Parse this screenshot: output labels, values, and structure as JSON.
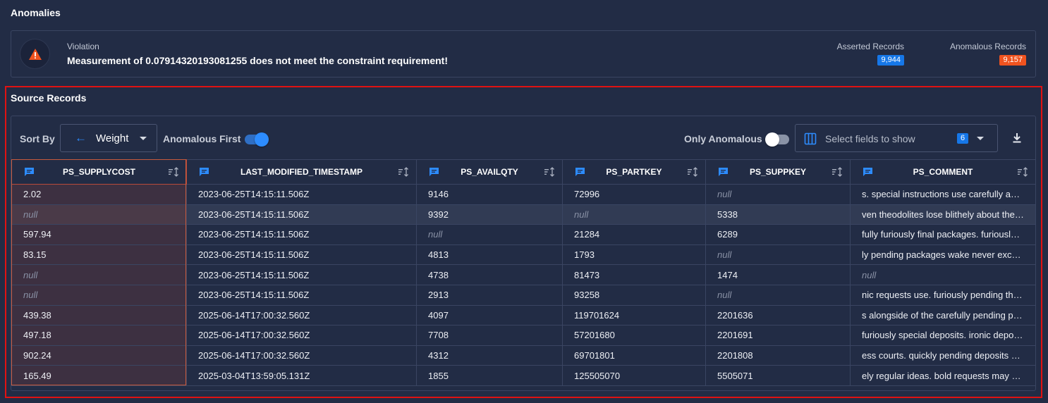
{
  "anomalies": {
    "title": "Anomalies",
    "violation_label": "Violation",
    "violation_text": "Measurement of 0.07914320193081255 does not meet the constraint requirement!",
    "asserted_label": "Asserted Records",
    "asserted_count": "9,944",
    "anomalous_label": "Anomalous Records",
    "anomalous_count": "9,157",
    "icon": "warning-triangle-icon",
    "accent_orange": "#f0531f",
    "accent_blue": "#1677e8"
  },
  "source": {
    "title": "Source Records",
    "sort_by_label": "Sort By",
    "sort_value": "Weight",
    "anomalous_first_label": "Anomalous First",
    "anomalous_first_on": true,
    "only_anomalous_label": "Only Anomalous",
    "only_anomalous_on": false,
    "fields_placeholder": "Select fields to show",
    "fields_count": "6"
  },
  "table": {
    "columns": [
      "PS_SUPPLYCOST",
      "LAST_MODIFIED_TIMESTAMP",
      "PS_AVAILQTY",
      "PS_PARTKEY",
      "PS_SUPPKEY",
      "PS_COMMENT"
    ],
    "rows": [
      [
        "2.02",
        "2023-06-25T14:15:11.506Z",
        "9146",
        "72996",
        "null",
        "s. special instructions use carefully across the"
      ],
      [
        "null",
        "2023-06-25T14:15:11.506Z",
        "9392",
        "null",
        "5338",
        "ven theodolites lose blithely about the slyly"
      ],
      [
        "597.94",
        "2023-06-25T14:15:11.506Z",
        "null",
        "21284",
        "6289",
        "fully furiously final packages. furiously even"
      ],
      [
        "83.15",
        "2023-06-25T14:15:11.506Z",
        "4813",
        "1793",
        "null",
        "ly pending packages wake never except the"
      ],
      [
        "null",
        "2023-06-25T14:15:11.506Z",
        "4738",
        "81473",
        "1474",
        "null"
      ],
      [
        "null",
        "2023-06-25T14:15:11.506Z",
        "2913",
        "93258",
        "null",
        "nic requests use. furiously pending theodolites"
      ],
      [
        "439.38",
        "2025-06-14T17:00:32.560Z",
        "4097",
        "119701624",
        "2201636",
        "s alongside of the carefully pending packages"
      ],
      [
        "497.18",
        "2025-06-14T17:00:32.560Z",
        "7708",
        "57201680",
        "2201691",
        "furiously special deposits. ironic deposits"
      ],
      [
        "902.24",
        "2025-06-14T17:00:32.560Z",
        "4312",
        "69701801",
        "2201808",
        "ess courts. quickly pending deposits slyly"
      ],
      [
        "165.49",
        "2025-03-04T13:59:05.131Z",
        "1855",
        "125505070",
        "5505071",
        "ely regular ideas. bold requests may eat quickly"
      ]
    ]
  }
}
